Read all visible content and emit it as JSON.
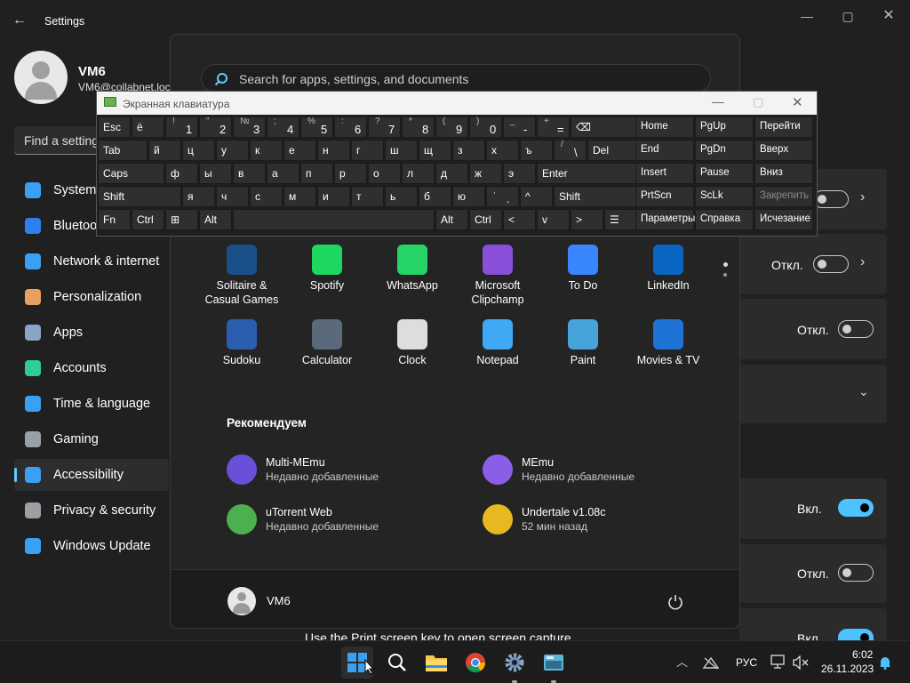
{
  "settings": {
    "title": "Settings",
    "user_name": "VM6",
    "user_email": "VM6@collabnet.loc",
    "find_placeholder": "Find a setting",
    "nav": [
      {
        "label": "System",
        "icon": "system-icon"
      },
      {
        "label": "Bluetooth & devices",
        "icon": "bluetooth-icon"
      },
      {
        "label": "Network & internet",
        "icon": "network-icon"
      },
      {
        "label": "Personalization",
        "icon": "brush-icon"
      },
      {
        "label": "Apps",
        "icon": "apps-icon"
      },
      {
        "label": "Accounts",
        "icon": "accounts-icon"
      },
      {
        "label": "Time & language",
        "icon": "time-icon"
      },
      {
        "label": "Gaming",
        "icon": "gaming-icon"
      },
      {
        "label": "Accessibility",
        "icon": "accessibility-icon"
      },
      {
        "label": "Privacy & security",
        "icon": "shield-icon"
      },
      {
        "label": "Windows Update",
        "icon": "update-icon"
      }
    ],
    "toggles": [
      {
        "label": "Откл.",
        "state": "off"
      },
      {
        "label": "Откл.",
        "state": "off"
      },
      {
        "label": "Вкл.",
        "state": "on"
      },
      {
        "label": "Откл.",
        "state": "off"
      },
      {
        "label": "Вкл.",
        "state": "on"
      }
    ],
    "bottom_text": "Use the Print screen key to open screen capture"
  },
  "start_menu": {
    "search_placeholder": "Search for apps, settings, and documents",
    "pinned": [
      {
        "name": "Solitaire & Casual Games",
        "icon": "solitaire-icon",
        "color": "#1a4f8a"
      },
      {
        "name": "Spotify",
        "icon": "spotify-icon",
        "color": "#1ed760"
      },
      {
        "name": "WhatsApp",
        "icon": "whatsapp-icon",
        "color": "#25d366"
      },
      {
        "name": "Microsoft Clipchamp",
        "icon": "clipchamp-icon",
        "color": "#8a4fd8"
      },
      {
        "name": "To Do",
        "icon": "todo-icon",
        "color": "#3a86ff"
      },
      {
        "name": "LinkedIn",
        "icon": "linkedin-icon",
        "color": "#0a66c2"
      },
      {
        "name": "Sudoku",
        "icon": "sudoku-icon",
        "color": "#2a5fb0"
      },
      {
        "name": "Calculator",
        "icon": "calculator-icon",
        "color": "#5a6a7a"
      },
      {
        "name": "Clock",
        "icon": "clock-icon",
        "color": "#dddddd"
      },
      {
        "name": "Notepad",
        "icon": "notepad-icon",
        "color": "#3fa9f5"
      },
      {
        "name": "Paint",
        "icon": "paint-icon",
        "color": "#47a3d9"
      },
      {
        "name": "Movies & TV",
        "icon": "movies-icon",
        "color": "#1e73d4"
      }
    ],
    "recommended_title": "Рекомендуем",
    "recommended": [
      {
        "title": "Multi-MEmu",
        "sub": "Недавно добавленные",
        "icon": "memu-multi-icon",
        "color": "#6a4fd8"
      },
      {
        "title": "MEmu",
        "sub": "Недавно добавленные",
        "icon": "memu-icon",
        "color": "#8a5fe8"
      },
      {
        "title": "uTorrent Web",
        "sub": "Недавно добавленные",
        "icon": "utorrent-icon",
        "color": "#4caf50"
      },
      {
        "title": "Undertale v1.08c",
        "sub": "52 мин назад",
        "icon": "archive-icon",
        "color": "#e8b820"
      }
    ],
    "user": "VM6"
  },
  "osk": {
    "title": "Экранная клавиатура",
    "rows": [
      [
        {
          "m": "Esc"
        },
        {
          "m": "ё"
        },
        {
          "t": "!",
          "b": "1"
        },
        {
          "t": "\"",
          "b": "2"
        },
        {
          "t": "№",
          "b": "3"
        },
        {
          "t": ";",
          "b": "4"
        },
        {
          "t": "%",
          "b": "5"
        },
        {
          "t": ":",
          "b": "6"
        },
        {
          "t": "?",
          "b": "7"
        },
        {
          "t": "*",
          "b": "8"
        },
        {
          "t": "(",
          "b": "9"
        },
        {
          "t": ")",
          "b": "0"
        },
        {
          "t": "_",
          "b": "-"
        },
        {
          "t": "+",
          "b": "="
        },
        {
          "m": "⌫"
        }
      ],
      [
        {
          "m": "Tab"
        },
        {
          "m": "й"
        },
        {
          "m": "ц"
        },
        {
          "m": "у"
        },
        {
          "m": "к"
        },
        {
          "m": "е"
        },
        {
          "m": "н"
        },
        {
          "m": "г"
        },
        {
          "m": "ш"
        },
        {
          "m": "щ"
        },
        {
          "m": "з"
        },
        {
          "m": "х"
        },
        {
          "m": "ъ"
        },
        {
          "t": "/",
          "b": "\\"
        },
        {
          "m": "Del"
        }
      ],
      [
        {
          "m": "Caps"
        },
        {
          "m": "ф"
        },
        {
          "m": "ы"
        },
        {
          "m": "в"
        },
        {
          "m": "а"
        },
        {
          "m": "п"
        },
        {
          "m": "р"
        },
        {
          "m": "о"
        },
        {
          "m": "л"
        },
        {
          "m": "д"
        },
        {
          "m": "ж"
        },
        {
          "m": "э"
        },
        {
          "m": "Enter"
        }
      ],
      [
        {
          "m": "Shift"
        },
        {
          "m": "я"
        },
        {
          "m": "ч"
        },
        {
          "m": "с"
        },
        {
          "m": "м"
        },
        {
          "m": "и"
        },
        {
          "m": "т"
        },
        {
          "m": "ь"
        },
        {
          "m": "б"
        },
        {
          "m": "ю"
        },
        {
          "t": ",",
          "b": "."
        },
        {
          "m": "^"
        },
        {
          "m": "Shift"
        }
      ],
      [
        {
          "m": "Fn"
        },
        {
          "m": "Ctrl"
        },
        {
          "m": "⊞"
        },
        {
          "m": "Alt"
        },
        {
          "m": ""
        },
        {
          "m": "Alt"
        },
        {
          "m": "Ctrl"
        },
        {
          "m": "<"
        },
        {
          "m": "v"
        },
        {
          "m": ">"
        },
        {
          "m": "☰"
        }
      ]
    ],
    "nav_keys": [
      [
        "Home",
        "PgUp",
        "Перейти"
      ],
      [
        "End",
        "PgDn",
        "Вверх"
      ],
      [
        "Insert",
        "Pause",
        "Вниз"
      ],
      [
        "PrtScn",
        "ScLk",
        "Закрепить"
      ],
      [
        "Параметры",
        "Справка",
        "Исчезание"
      ]
    ]
  },
  "taskbar": {
    "lang": "РУС",
    "time": "6:02",
    "date": "26.11.2023"
  }
}
